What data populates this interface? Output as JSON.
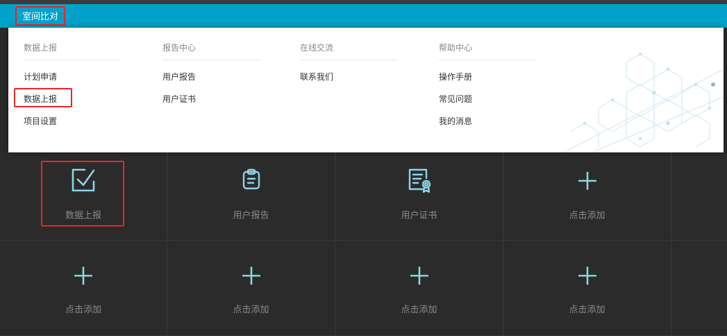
{
  "navbar": {
    "active_tab": "室间比对"
  },
  "menu": {
    "columns": [
      {
        "title": "数据上报",
        "items": [
          "计划申请",
          "数据上报",
          "项目设置"
        ]
      },
      {
        "title": "报告中心",
        "items": [
          "用户报告",
          "用户证书"
        ]
      },
      {
        "title": "在线交流",
        "items": [
          "联系我们"
        ]
      },
      {
        "title": "帮助中心",
        "items": [
          "操作手册",
          "常见问题",
          "我的消息"
        ]
      }
    ]
  },
  "tiles": [
    {
      "label": "数据上报",
      "icon": "check-square-icon"
    },
    {
      "label": "用户报告",
      "icon": "clipboard-icon"
    },
    {
      "label": "用户证书",
      "icon": "certificate-icon"
    },
    {
      "label": "点击添加",
      "icon": "plus-icon"
    },
    {
      "label": "点击添加",
      "icon": "plus-icon"
    },
    {
      "label": "点击添加",
      "icon": "plus-icon"
    },
    {
      "label": "点击添加",
      "icon": "plus-icon"
    },
    {
      "label": "点击添加",
      "icon": "plus-icon"
    }
  ],
  "colors": {
    "navbar": "#00a2c9",
    "highlight": "#e8262b",
    "icon": "#8ed4e6",
    "tile_bg": "#2b2b2b"
  }
}
